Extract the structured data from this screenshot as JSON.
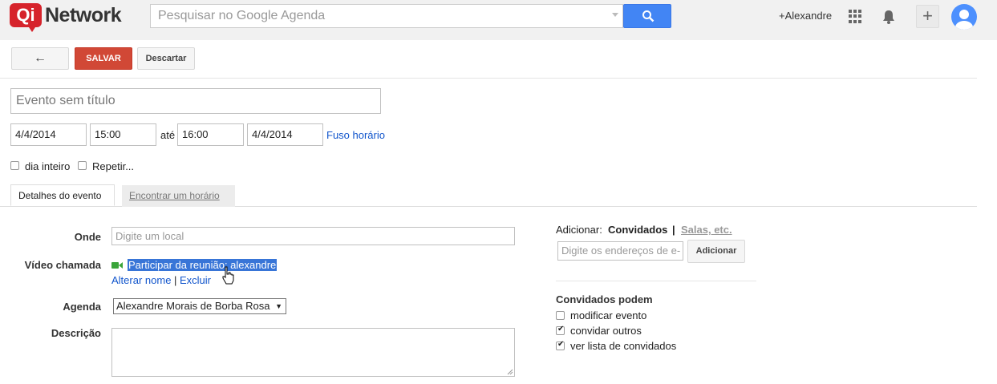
{
  "brand": {
    "badge": "Qi",
    "name": "Network",
    "color": "#d6232b"
  },
  "search": {
    "placeholder": "Pesquisar no Google Agenda",
    "button_icon": "search-icon"
  },
  "header": {
    "user": "+Alexandre",
    "apps_icon": "apps-grid-icon",
    "notifications_icon": "bell-icon",
    "add_label": "+",
    "avatar_icon": "user-avatar-icon"
  },
  "toolbar": {
    "back_label": "←",
    "save_label": "SALVAR",
    "discard_label": "Descartar"
  },
  "event": {
    "title_placeholder": "Evento sem título",
    "start_date": "4/4/2014",
    "start_time": "15:00",
    "to_label": "até",
    "end_time": "16:00",
    "end_date": "4/4/2014",
    "timezone_link": "Fuso horário",
    "all_day_label": "dia inteiro",
    "all_day_checked": false,
    "repeat_label": "Repetir...",
    "repeat_checked": false
  },
  "tabs": [
    {
      "label": "Detalhes do evento",
      "active": true
    },
    {
      "label": "Encontrar um horário",
      "active": false
    }
  ],
  "details": {
    "where_label": "Onde",
    "where_placeholder": "Digite um local",
    "video_label": "Vídeo chamada",
    "video_link": "Participar da reunião: alexandre",
    "rename_link": "Alterar nome",
    "separator": "|",
    "delete_link": "Excluir",
    "calendar_label": "Agenda",
    "calendar_value": "Alexandre Morais de Borba Rosa",
    "description_label": "Descrição"
  },
  "guests": {
    "add_label": "Adicionar:",
    "guests_tab": "Convidados",
    "separator": "|",
    "rooms_tab": "Salas, etc.",
    "input_placeholder": "Digite os endereços de e-",
    "add_button": "Adicionar",
    "permissions_title": "Convidados podem",
    "permissions": [
      {
        "label": "modificar evento",
        "checked": false
      },
      {
        "label": "convidar outros",
        "checked": true
      },
      {
        "label": "ver lista de convidados",
        "checked": true
      }
    ]
  }
}
